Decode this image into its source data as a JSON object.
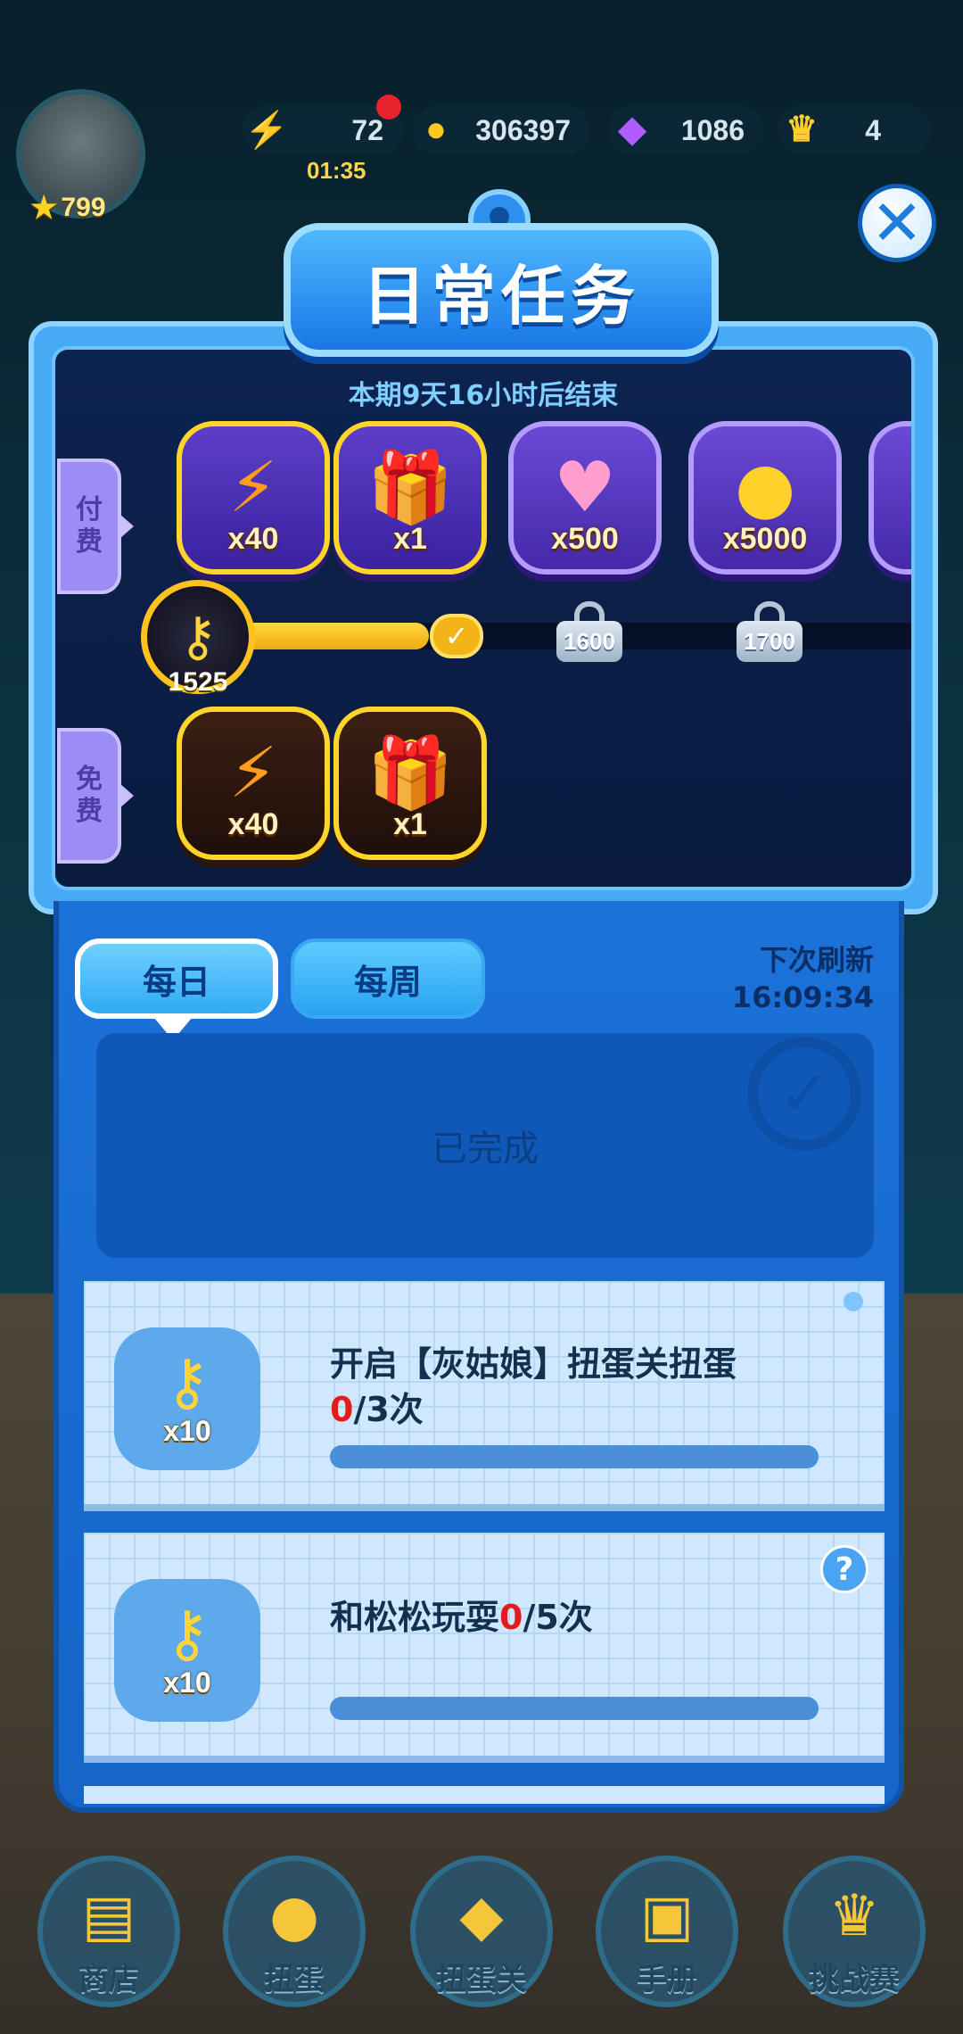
{
  "hud": {
    "level": "799",
    "energy": "72",
    "energy_timer": "01:35",
    "coins": "306397",
    "gems": "1086",
    "crowns": "4"
  },
  "title": "日常任务",
  "track": {
    "end_time": "本期9天16小时后结束",
    "paid_label": [
      "付",
      "费"
    ],
    "free_label": [
      "免",
      "费"
    ],
    "keys": "1525",
    "paid_rewards": [
      {
        "icon": "lightning-icon",
        "count": "x40"
      },
      {
        "icon": "gift-box-icon",
        "count": "x1"
      },
      {
        "icon": "heart-icon",
        "count": "x500"
      },
      {
        "icon": "coin-icon",
        "count": "x5000"
      }
    ],
    "free_rewards": [
      {
        "icon": "lightning-icon",
        "count": "x40"
      },
      {
        "icon": "gift-box-icon",
        "count": "x1"
      }
    ],
    "milestones": [
      "1600",
      "1700"
    ],
    "progress_fraction": 0.34
  },
  "tabs": {
    "daily": "每日",
    "weekly": "每周",
    "refresh_label": "下次刷新",
    "refresh_time": "16:09:34"
  },
  "completed_label": "已完成",
  "tasks": [
    {
      "reward": "x10",
      "text": "开启【灰姑娘】扭蛋关扭蛋",
      "progress_current": "0",
      "progress_rest": "/3次",
      "progress_fraction": 0.0
    },
    {
      "reward": "x10",
      "text": "和松松玩耍",
      "progress_current": "0",
      "progress_rest": "/5次",
      "progress_fraction": 0.0
    }
  ],
  "nav": [
    {
      "label": "商店",
      "icon": "shop-icon"
    },
    {
      "label": "扭蛋",
      "icon": "gacha-icon"
    },
    {
      "label": "扭蛋关",
      "icon": "gacha-stage-icon"
    },
    {
      "label": "手册",
      "icon": "album-icon"
    },
    {
      "label": "挑战赛",
      "icon": "challenge-icon"
    }
  ]
}
